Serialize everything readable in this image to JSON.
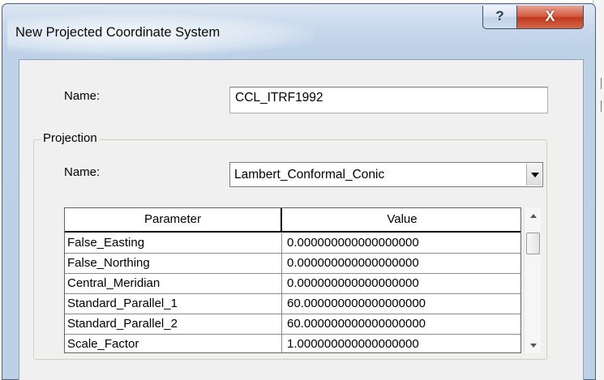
{
  "window": {
    "title": "New Projected Coordinate System",
    "help_glyph": "?",
    "close_glyph": "X"
  },
  "name_field": {
    "label": "Name:",
    "value": "CCL_ITRF1992"
  },
  "projection": {
    "group_title": "Projection",
    "name_label": "Name:",
    "selected": "Lambert_Conformal_Conic"
  },
  "parameters": {
    "columns": [
      "Parameter",
      "Value"
    ],
    "rows": [
      {
        "parameter": "False_Easting",
        "value": "0.000000000000000000"
      },
      {
        "parameter": "False_Northing",
        "value": "0.000000000000000000"
      },
      {
        "parameter": "Central_Meridian",
        "value": "0.000000000000000000"
      },
      {
        "parameter": "Standard_Parallel_1",
        "value": "60.000000000000000000"
      },
      {
        "parameter": "Standard_Parallel_2",
        "value": "60.000000000000000000"
      },
      {
        "parameter": "Scale_Factor",
        "value": "1.000000000000000000"
      }
    ]
  }
}
